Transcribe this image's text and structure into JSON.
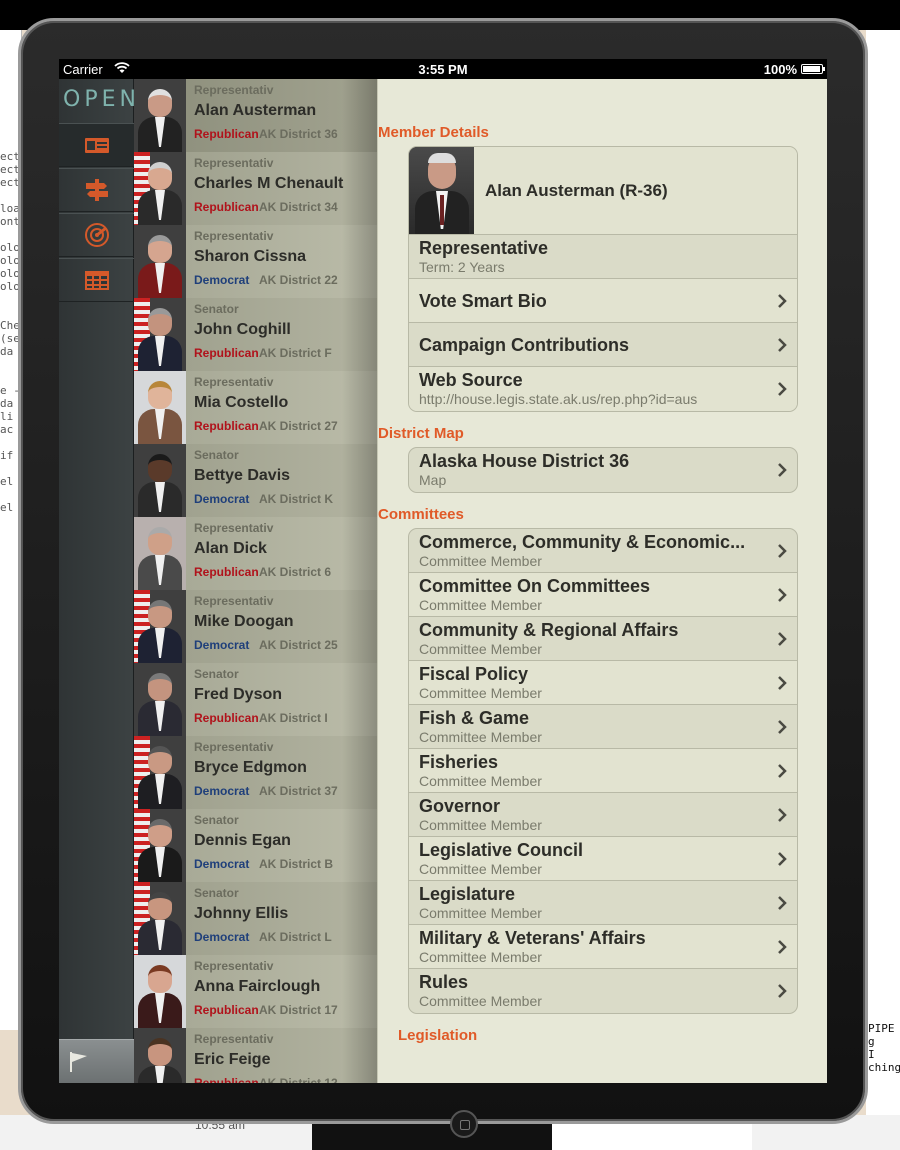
{
  "status_bar": {
    "carrier": "Carrier",
    "time": "3:55 PM",
    "battery": "100%"
  },
  "app": {
    "logo": "OPEN",
    "nav": [
      {
        "name": "members-nav",
        "icon": "id-card-icon",
        "active": true
      },
      {
        "name": "districts-nav",
        "icon": "signpost-icon",
        "active": false
      },
      {
        "name": "map-nav",
        "icon": "radar-icon",
        "active": false
      },
      {
        "name": "calendar-nav",
        "icon": "calendar-icon",
        "active": false
      }
    ],
    "accent": "#e05a28"
  },
  "members": [
    {
      "role": "Representativ",
      "name": "Alan Austerman",
      "party": "Republican",
      "district": "AK District 36"
    },
    {
      "role": "Representativ",
      "name": "Charles M Chenault",
      "party": "Republican",
      "district": "AK District 34"
    },
    {
      "role": "Representativ",
      "name": "Sharon Cissna",
      "party": "Democrat",
      "district": "AK District 22"
    },
    {
      "role": "Senator",
      "name": "John Coghill",
      "party": "Republican",
      "district": "AK District F"
    },
    {
      "role": "Representativ",
      "name": "Mia Costello",
      "party": "Republican",
      "district": "AK District 27"
    },
    {
      "role": "Senator",
      "name": "Bettye Davis",
      "party": "Democrat",
      "district": "AK District K"
    },
    {
      "role": "Representativ",
      "name": "Alan Dick",
      "party": "Republican",
      "district": "AK District 6"
    },
    {
      "role": "Representativ",
      "name": "Mike Doogan",
      "party": "Democrat",
      "district": "AK District 25"
    },
    {
      "role": "Senator",
      "name": "Fred Dyson",
      "party": "Republican",
      "district": "AK District I"
    },
    {
      "role": "Representativ",
      "name": "Bryce Edgmon",
      "party": "Democrat",
      "district": "AK District 37"
    },
    {
      "role": "Senator",
      "name": "Dennis Egan",
      "party": "Democrat",
      "district": "AK District B"
    },
    {
      "role": "Senator",
      "name": "Johnny Ellis",
      "party": "Democrat",
      "district": "AK District L"
    },
    {
      "role": "Representativ",
      "name": "Anna Fairclough",
      "party": "Republican",
      "district": "AK District 17"
    },
    {
      "role": "Representativ",
      "name": "Eric Feige",
      "party": "Republican",
      "district": "AK District 12"
    }
  ],
  "detail": {
    "member_details_header": "Member Details",
    "member_title": "Alan Austerman (R-36)",
    "role": "Representative",
    "term": "Term: 2 Years",
    "vote_smart": "Vote Smart Bio",
    "campaign": "Campaign Contributions",
    "web_source_title": "Web Source",
    "web_source_url": "http://house.legis.state.ak.us/rep.php?id=aus",
    "district_map_header": "District Map",
    "district_title": "Alaska House District 36",
    "district_sub": "Map",
    "committees_header": "Committees",
    "committees": [
      {
        "name": "Commerce, Community & Economic...",
        "role": "Committee Member"
      },
      {
        "name": "Committee On Committees",
        "role": "Committee Member"
      },
      {
        "name": "Community & Regional Affairs",
        "role": "Committee Member"
      },
      {
        "name": "Fiscal Policy",
        "role": "Committee Member"
      },
      {
        "name": "Fish & Game",
        "role": "Committee Member"
      },
      {
        "name": "Fisheries",
        "role": "Committee Member"
      },
      {
        "name": "Governor",
        "role": "Committee Member"
      },
      {
        "name": "Legislative Council",
        "role": "Committee Member"
      },
      {
        "name": "Legislature",
        "role": "Committee Member"
      },
      {
        "name": "Military & Veterans' Affairs",
        "role": "Committee Member"
      },
      {
        "name": "Rules",
        "role": "Committee Member"
      }
    ],
    "legislation_header": "Legislation"
  },
  "background": {
    "left_code": [
      "ect",
      "ect",
      "ect",
      "",
      "loa",
      "ont",
      "",
      "olo",
      "olo",
      "olo",
      "olo",
      "",
      "",
      "Che",
      "(se",
      " da",
      "",
      "",
      "e -",
      " da",
      " li",
      " ac",
      "",
      " if",
      "",
      " el",
      "",
      " el"
    ],
    "right_code": [
      "PIPE",
      "g",
      " I",
      "ching"
    ],
    "time": "10:55 am"
  }
}
